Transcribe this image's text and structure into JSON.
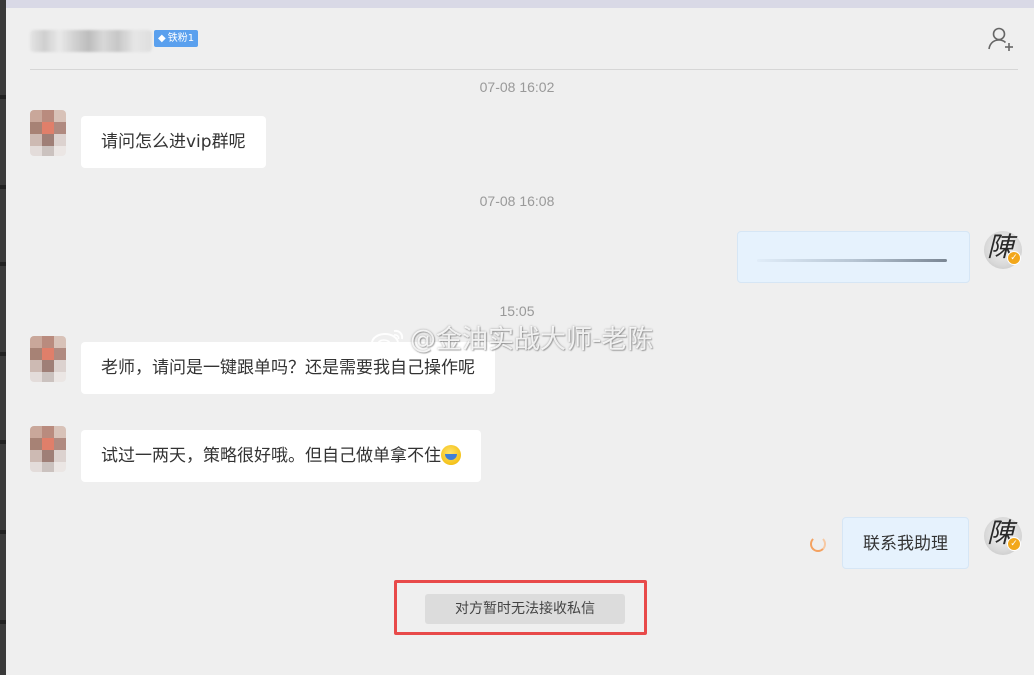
{
  "header": {
    "badge_icon": "diamond-icon",
    "badge_label": "铁粉1",
    "action_icon": "add-user-icon"
  },
  "messages": [
    {
      "type": "time",
      "text": "07-08 16:02"
    },
    {
      "type": "incoming",
      "text": "请问怎么进vip群呢"
    },
    {
      "type": "time",
      "text": "07-08 16:08"
    },
    {
      "type": "outgoing",
      "text": ""
    },
    {
      "type": "time",
      "text": "15:05"
    },
    {
      "type": "incoming",
      "text": "老师，请问是一键跟单吗？还是需要我自己操作呢"
    },
    {
      "type": "incoming",
      "text": "试过一两天，策略很好哦。但自己做单拿不住",
      "emoji": "crying-laughing-icon"
    },
    {
      "type": "outgoing",
      "text": "联系我助理",
      "status_icon": "sending-spinner-icon"
    }
  ],
  "system_notice": "对方暂时无法接收私信",
  "watermark": "@金油实战大师-老陈",
  "colors": {
    "badge": "#5aa0ee",
    "outgoing_bubble": "#e6f2fd",
    "incoming_bubble": "#ffffff",
    "highlight_frame": "#e84a4a",
    "verified": "#f2a71b"
  }
}
